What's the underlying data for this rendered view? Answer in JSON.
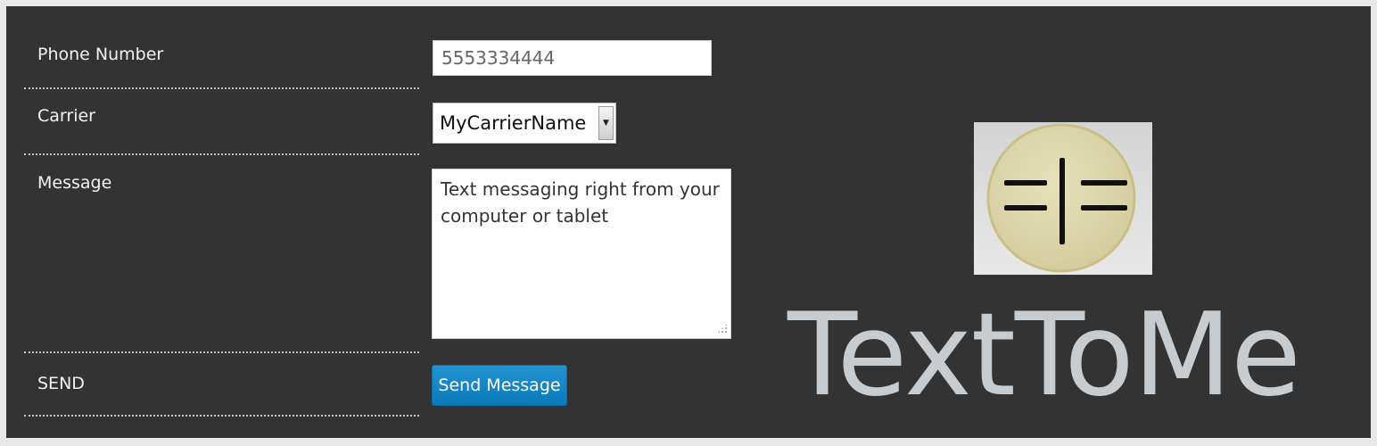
{
  "form": {
    "phone": {
      "label": "Phone Number",
      "value": "5553334444"
    },
    "carrier": {
      "label": "Carrier",
      "selected": "MyCarrierName"
    },
    "message": {
      "label": "Message",
      "value": "Text messaging right from your computer or tablet"
    },
    "send": {
      "label": "SEND",
      "button_label": "Send Message"
    }
  },
  "brand": {
    "name": "TextToMe",
    "logo_icon": "equals-bar-equals-icon"
  },
  "colors": {
    "panel_bg": "#333333",
    "button": "#1a88c8",
    "brand_text": "#c7ccd1",
    "logo_circle": "#ddd8ae"
  }
}
